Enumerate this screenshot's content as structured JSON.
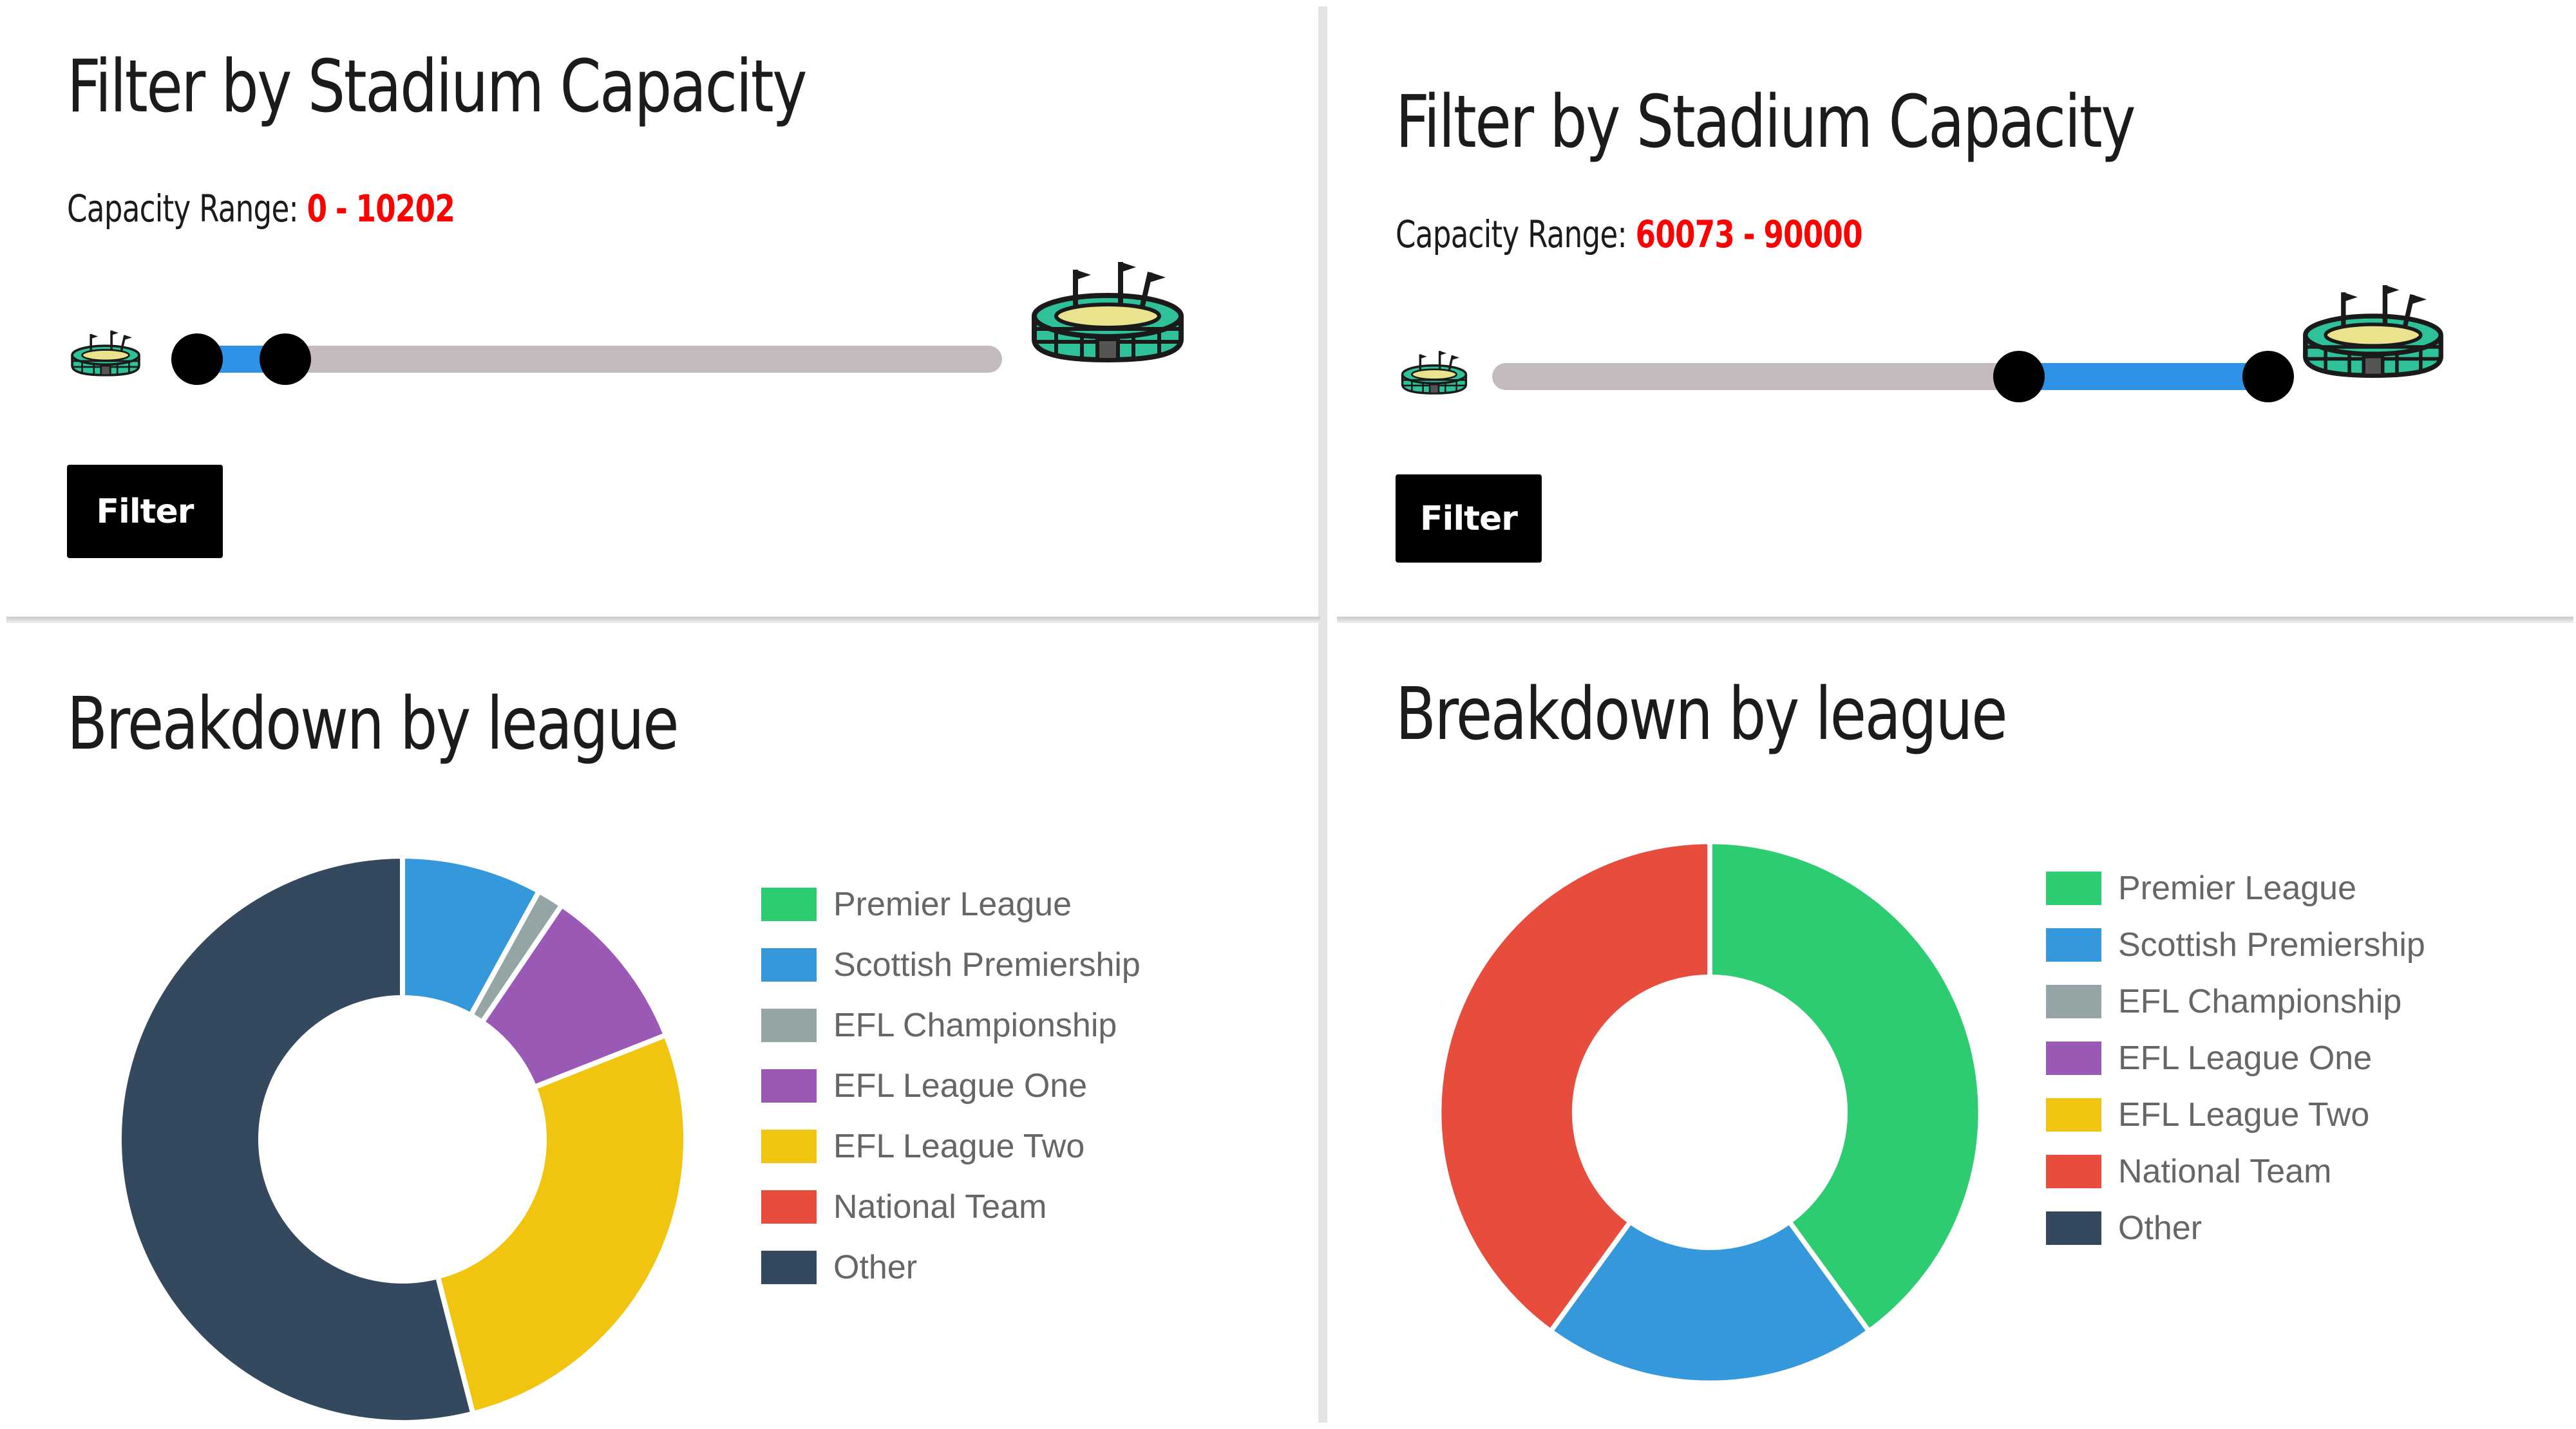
{
  "panels": [
    {
      "filter": {
        "title": "Filter by Stadium Capacity",
        "range_label": "Capacity Range:",
        "range_low": "0",
        "range_separator": "-",
        "range_high": "10202",
        "slider": {
          "min": 0,
          "max": 90000,
          "low": 0,
          "high": 10202
        },
        "button_label": "Filter"
      },
      "breakdown": {
        "title": "Breakdown by league",
        "chart_data": {
          "type": "pie",
          "categories": [
            "Premier League",
            "Scottish Premiership",
            "EFL Championship",
            "EFL League One",
            "EFL League Two",
            "National Team",
            "Other"
          ],
          "values": [
            0,
            8,
            1.5,
            9.5,
            27,
            0,
            54
          ],
          "colors": [
            "#2ecc71",
            "#3498db",
            "#95a5a6",
            "#9b59b6",
            "#f1c40f",
            "#e74c3c",
            "#34495e"
          ],
          "legend_position": "right"
        }
      }
    },
    {
      "filter": {
        "title": "Filter by Stadium Capacity",
        "range_label": "Capacity Range:",
        "range_low": "60073",
        "range_separator": "-",
        "range_high": "90000",
        "slider": {
          "min": 0,
          "max": 90000,
          "low": 60073,
          "high": 90000
        },
        "button_label": "Filter"
      },
      "breakdown": {
        "title": "Breakdown by league",
        "chart_data": {
          "type": "pie",
          "categories": [
            "Premier League",
            "Scottish Premiership",
            "EFL Championship",
            "EFL League One",
            "EFL League Two",
            "National Team",
            "Other"
          ],
          "values": [
            40,
            20,
            0,
            0,
            0,
            40,
            0
          ],
          "colors": [
            "#2ecc71",
            "#3498db",
            "#95a5a6",
            "#9b59b6",
            "#f1c40f",
            "#e74c3c",
            "#34495e"
          ],
          "legend_position": "right"
        }
      }
    }
  ],
  "icons": {
    "small": "stadium-icon",
    "large": "stadium-icon"
  },
  "colors": {
    "slider_fill": "#2e93e6",
    "slider_track": "#c4bcbc",
    "range_value": "#ff0000",
    "button": "#000000"
  }
}
